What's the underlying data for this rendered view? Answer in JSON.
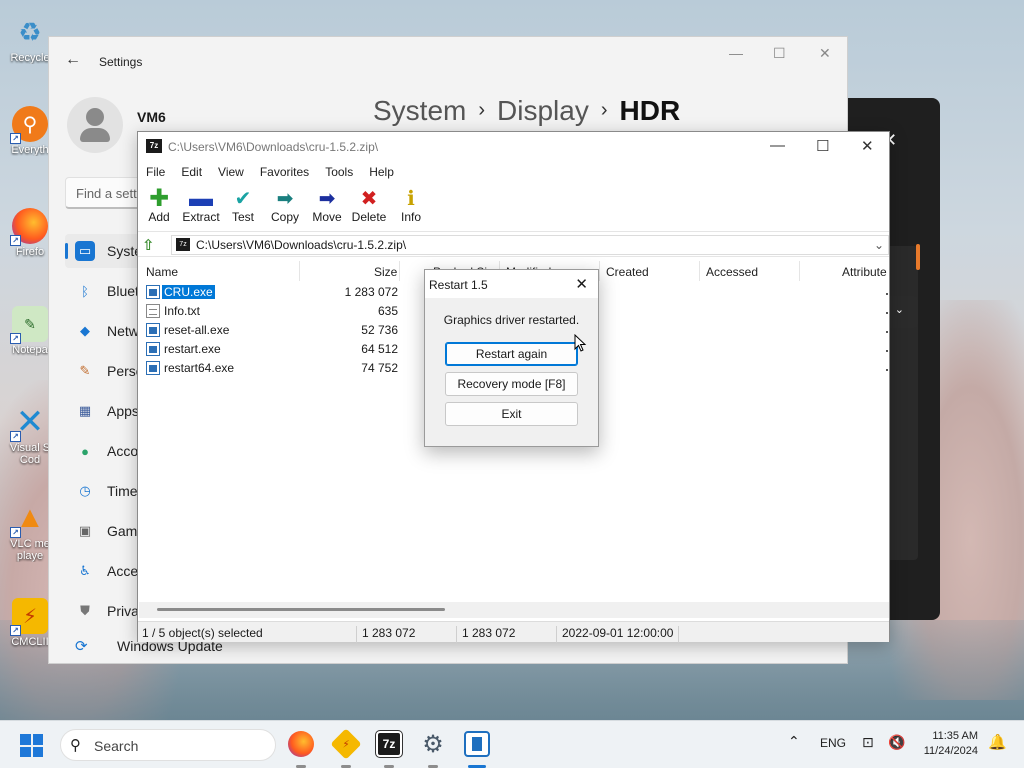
{
  "desktop": {
    "icons": [
      {
        "label": "Recycle",
        "icon": "recycle-bin-icon"
      },
      {
        "label": "Everyth",
        "icon": "everything-search-icon"
      },
      {
        "label": "Firefo",
        "icon": "firefox-icon"
      },
      {
        "label": "Notepa",
        "icon": "notepad-icon"
      },
      {
        "label": "Visual S",
        "label2": "Cod",
        "icon": "vscode-icon"
      },
      {
        "label": "VLC me",
        "label2": "playe",
        "icon": "vlc-icon"
      },
      {
        "label": "CMCLII",
        "icon": "cmclient-icon"
      }
    ]
  },
  "settings": {
    "title": "Settings",
    "user_name": "VM6",
    "breadcrumb": [
      "System",
      "Display",
      "HDR"
    ],
    "find_placeholder": "Find a setti",
    "nav": [
      {
        "label": "Syste",
        "icon": "system-icon",
        "selected": true
      },
      {
        "label": "Bluet",
        "icon": "bluetooth-icon"
      },
      {
        "label": "Netw",
        "icon": "network-icon"
      },
      {
        "label": "Perso",
        "icon": "personalization-icon"
      },
      {
        "label": "Apps",
        "icon": "apps-icon"
      },
      {
        "label": "Acco",
        "icon": "accounts-icon"
      },
      {
        "label": "Time",
        "icon": "time-language-icon"
      },
      {
        "label": "Gam",
        "icon": "gaming-icon"
      },
      {
        "label": "Acce",
        "icon": "accessibility-icon"
      },
      {
        "label": "Priva",
        "icon": "privacy-icon"
      }
    ],
    "windows_update": "Windows Update"
  },
  "sevenzip": {
    "title": "C:\\Users\\VM6\\Downloads\\cru-1.5.2.zip\\",
    "menu": [
      "File",
      "Edit",
      "View",
      "Favorites",
      "Tools",
      "Help"
    ],
    "toolbar": [
      {
        "label": "Add",
        "icon": "add-icon",
        "color": "#2e9e2e"
      },
      {
        "label": "Extract",
        "icon": "extract-icon",
        "color": "#1c3fb5"
      },
      {
        "label": "Test",
        "icon": "test-icon",
        "color": "#1aa3a3"
      },
      {
        "label": "Copy",
        "icon": "copy-icon",
        "color": "#1a7f7f"
      },
      {
        "label": "Move",
        "icon": "move-icon",
        "color": "#1c2f9e"
      },
      {
        "label": "Delete",
        "icon": "delete-icon",
        "color": "#d12020"
      },
      {
        "label": "Info",
        "icon": "info-icon",
        "color": "#c7a200"
      }
    ],
    "address": "C:\\Users\\VM6\\Downloads\\cru-1.5.2.zip\\",
    "columns": [
      "Name",
      "Size",
      "Packed Size",
      "Modified",
      "Created",
      "Accessed",
      "Attribute"
    ],
    "files": [
      {
        "name": "CRU.exe",
        "size": "1 283 072",
        "type": "exe",
        "selected": true
      },
      {
        "name": "Info.txt",
        "size": "635",
        "type": "txt"
      },
      {
        "name": "reset-all.exe",
        "size": "52 736",
        "type": "exe"
      },
      {
        "name": "restart.exe",
        "size": "64 512",
        "type": "exe"
      },
      {
        "name": "restart64.exe",
        "size": "74 752",
        "type": "exe"
      }
    ],
    "status": {
      "selected": "1 / 5 object(s) selected",
      "size": "1 283 072",
      "packed": "1 283 072",
      "modified": "2022-09-01 12:00:00"
    }
  },
  "dialog": {
    "title": "Restart 1.5",
    "message": "Graphics driver restarted.",
    "buttons": [
      "Restart again",
      "Recovery mode [F8]",
      "Exit"
    ]
  },
  "taskbar": {
    "search_placeholder": "Search",
    "apps": [
      "firefox-icon",
      "cmclient-icon",
      "7zip-icon",
      "settings-gear-icon",
      "cru-icon"
    ],
    "zip_label": "7z",
    "lang": "ENG",
    "time": "11:35 AM",
    "date": "11/24/2024"
  }
}
